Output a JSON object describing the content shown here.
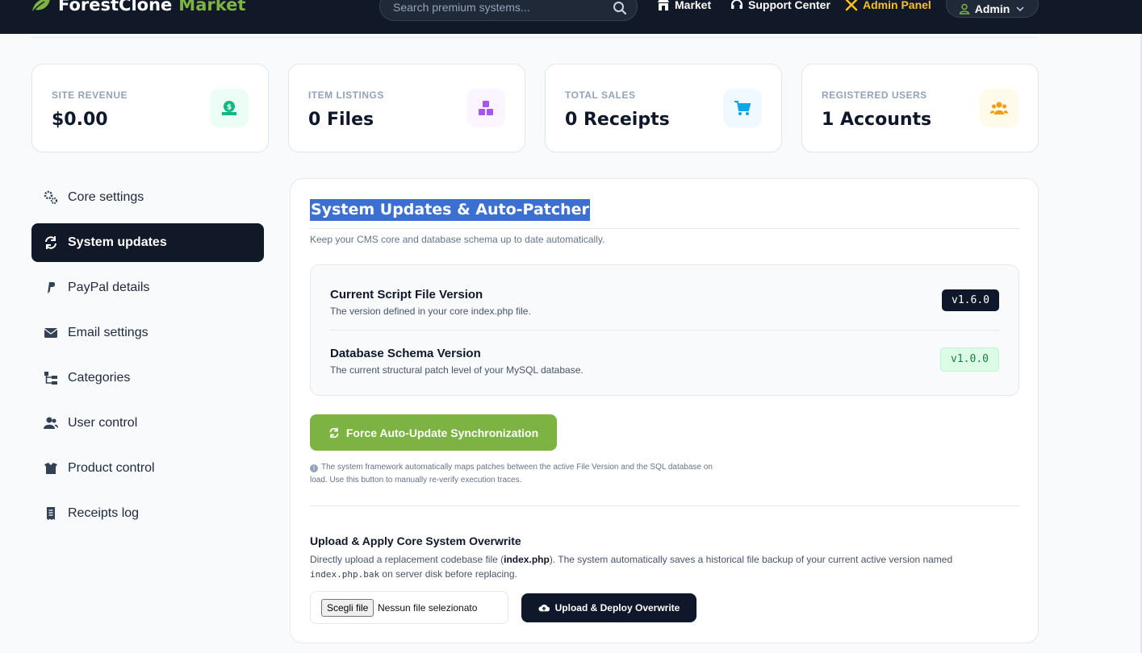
{
  "navbar": {
    "brand_main": "ForestClone",
    "brand_accent": "Market",
    "search_placeholder": "Search premium systems...",
    "links": {
      "market": "Market",
      "support": "Support Center",
      "admin_panel": "Admin Panel"
    },
    "user_label": "Admin"
  },
  "stats": [
    {
      "label": "Site Revenue",
      "value": "$0.00",
      "icon": "money-icon",
      "color": "#10b981"
    },
    {
      "label": "Item Listings",
      "value": "0 Files",
      "icon": "boxes-icon",
      "color": "#a855f7"
    },
    {
      "label": "Total Sales",
      "value": "0 Receipts",
      "icon": "cart-icon",
      "color": "#0ea5e9"
    },
    {
      "label": "Registered Users",
      "value": "1 Accounts",
      "icon": "users-icon",
      "color": "#f59e0b"
    }
  ],
  "sidebar": {
    "items": [
      {
        "label": "Core settings",
        "icon": "gears-icon"
      },
      {
        "label": "System updates",
        "icon": "sync-icon",
        "active": true
      },
      {
        "label": "PayPal details",
        "icon": "paypal-icon"
      },
      {
        "label": "Email settings",
        "icon": "envelope-icon"
      },
      {
        "label": "Categories",
        "icon": "sitemap-icon"
      },
      {
        "label": "User control",
        "icon": "users-icon"
      },
      {
        "label": "Product control",
        "icon": "box-open-icon"
      },
      {
        "label": "Receipts log",
        "icon": "receipt-icon"
      }
    ]
  },
  "main": {
    "title": "System Updates & Auto-Patcher",
    "subtitle": "Keep your CMS core and database schema up to date automatically.",
    "versions": [
      {
        "title": "Current Script File Version",
        "desc": "The version defined in your core index.php file.",
        "badge": "v1.6.0"
      },
      {
        "title": "Database Schema Version",
        "desc": "The current structural patch level of your MySQL database.",
        "badge": "v1.0.0"
      }
    ],
    "force_button": "Force Auto-Update Synchronization",
    "note": "The system framework automatically maps patches between the active File Version and the SQL database on load. Use this button to manually re-verify execution traces.",
    "upload": {
      "title": "Upload & Apply Core System Overwrite",
      "desc_1": "Directly upload a replacement codebase file (",
      "desc_file": "index.php",
      "desc_2": "). The system automatically saves a historical file backup of your current active version named ",
      "desc_backup": "index.php.bak",
      "desc_3": " on server disk before replacing.",
      "choose_file": "Scegli file",
      "no_file": "Nessun file selezionato",
      "deploy_button": "Upload & Deploy Overwrite"
    }
  }
}
